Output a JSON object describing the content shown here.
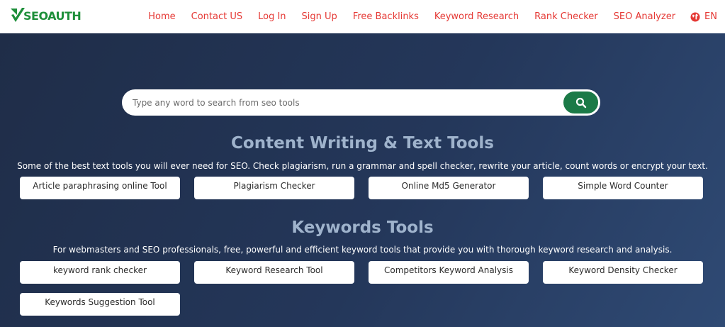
{
  "brand": {
    "logo_text": "SEOAUTH",
    "accent_color": "#1e8f3a"
  },
  "nav": {
    "items": [
      "Home",
      "Contact US",
      "Log In",
      "Sign Up",
      "Free Backlinks",
      "Keyword Research",
      "Rank Checker",
      "SEO Analyzer"
    ],
    "language": "EN",
    "link_color": "#e53935"
  },
  "search": {
    "placeholder": "Type any word to search from seo tools",
    "button_color": "#1b7a47"
  },
  "sections": [
    {
      "title": "Content Writing & Text Tools",
      "description": "Some of the best text tools you will ever need for SEO. Check plagiarism, run a grammar and spell checker, rewrite your article, count words or encrypt your text.",
      "tools": [
        "Article paraphrasing online Tool",
        "Plagiarism Checker",
        "Online Md5 Generator",
        "Simple Word Counter"
      ]
    },
    {
      "title": "Keywords Tools",
      "description": "For webmasters and SEO professionals, free, powerful and efficient keyword tools that provide you with thorough keyword research and analysis.",
      "tools": [
        "keyword rank checker",
        "Keyword Research Tool",
        "Competitors Keyword Analysis",
        "Keyword Density Checker",
        "Keywords Suggestion Tool"
      ]
    }
  ]
}
